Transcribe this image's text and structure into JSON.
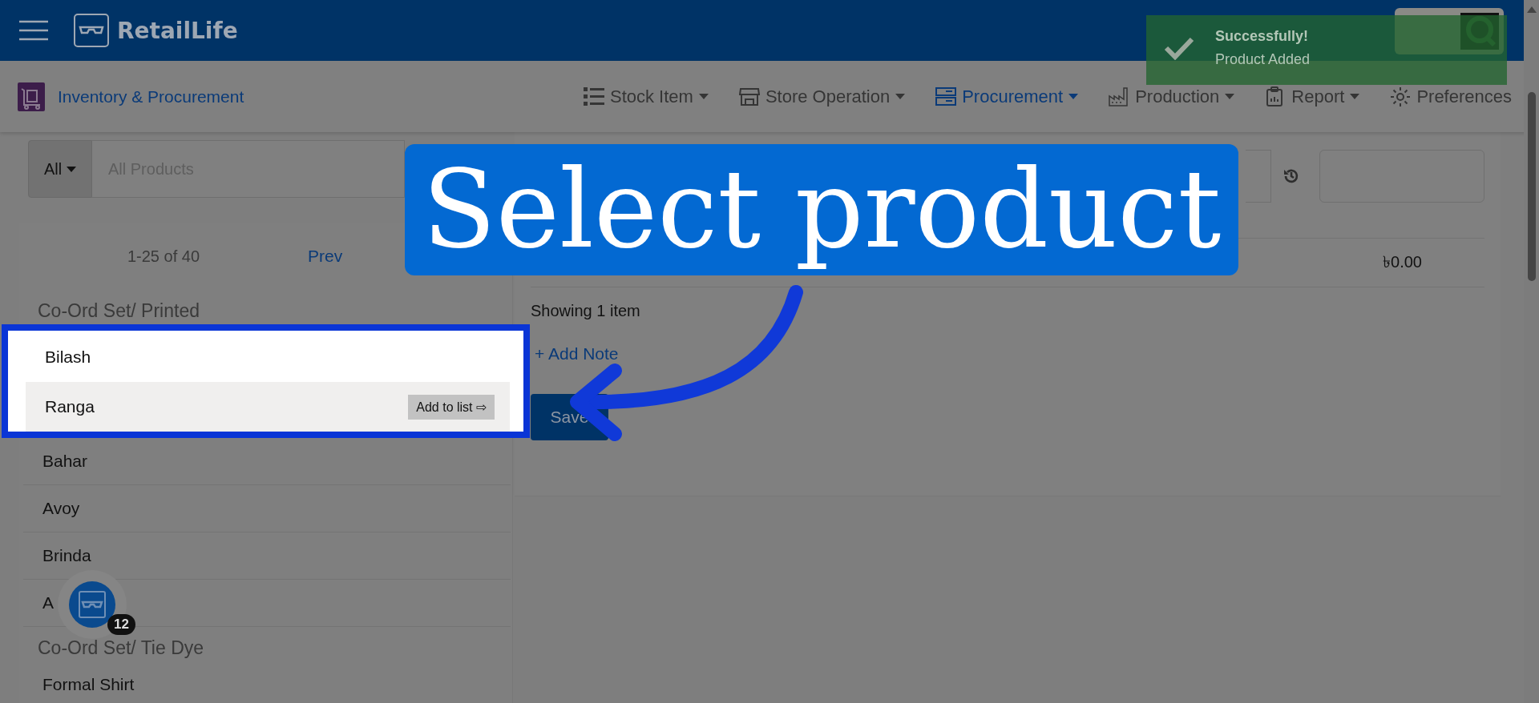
{
  "app": {
    "title": "RetailLife"
  },
  "module": {
    "title": "Inventory & Procurement"
  },
  "nav": [
    {
      "label": "Stock Item",
      "selected": false,
      "dropdown": true
    },
    {
      "label": "Store Operation",
      "selected": false,
      "dropdown": true
    },
    {
      "label": "Procurement",
      "selected": true,
      "dropdown": true
    },
    {
      "label": "Production",
      "selected": false,
      "dropdown": true
    },
    {
      "label": "Report",
      "selected": false,
      "dropdown": true
    },
    {
      "label": "Preferences",
      "selected": false,
      "dropdown": false
    }
  ],
  "toast": {
    "title": "Successfully!",
    "message": "Product Added"
  },
  "search": {
    "filter": "All",
    "placeholder": "All Products"
  },
  "pagination": {
    "range": "1-25 of 40",
    "prev": "Prev"
  },
  "product_groups": [
    {
      "name": "Co-Ord Set/ Printed",
      "items": [
        {
          "name": "Bilash",
          "hovered": false,
          "spotlight": true
        },
        {
          "name": "Ranga",
          "hovered": true,
          "spotlight": true,
          "action": "Add to list ⇨"
        },
        {
          "name": "Bahar",
          "hovered": false,
          "spotlight": false
        },
        {
          "name": "Avoy",
          "hovered": false,
          "spotlight": false
        },
        {
          "name": "Brinda",
          "hovered": false,
          "spotlight": false
        },
        {
          "name": "A",
          "hovered": false,
          "spotlight": false
        }
      ]
    },
    {
      "name": "Co-Ord Set/ Tie Dye",
      "items": [
        {
          "name": "Formal Shirt",
          "hovered": false,
          "spotlight": false
        }
      ]
    }
  ],
  "order": {
    "total": "৳0.00",
    "count": "Showing 1 item",
    "add_note": "+ Add Note",
    "save": "Save"
  },
  "floating_badge": {
    "count": "12"
  },
  "tutorial": {
    "callout": "Select product"
  }
}
